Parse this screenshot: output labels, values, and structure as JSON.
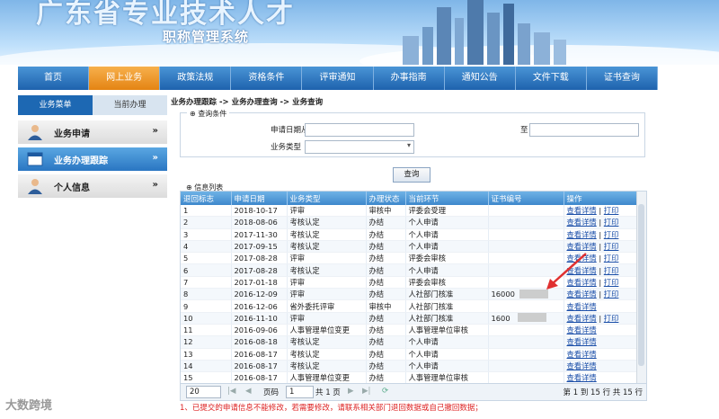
{
  "banner": {
    "title": "广东省专业技术人才",
    "subtitle": "职称管理系统"
  },
  "nav": [
    "首页",
    "网上业务",
    "政策法规",
    "资格条件",
    "评审通知",
    "办事指南",
    "通知公告",
    "文件下载",
    "证书查询"
  ],
  "left": {
    "tabs": [
      "业务菜单",
      "当前办理"
    ],
    "menu": [
      "业务申请",
      "业务办理跟踪",
      "个人信息"
    ],
    "arrow": "»"
  },
  "crumb": "业务办理跟踪 -> 业务办理查询 -> 业务查询",
  "query": {
    "legend": "查询条件",
    "date_from_label": "申请日期从",
    "date_to_label": "至",
    "type_label": "业务类型",
    "button": "查询"
  },
  "list_label": "信息列表",
  "table": {
    "headers": [
      "退回标志",
      "申请日期",
      "业务类型",
      "办理状态",
      "当前环节",
      "证书编号",
      "操作"
    ],
    "rows": [
      [
        "1",
        "2018-10-17",
        "评审",
        "审核中",
        "评委会受理",
        "",
        "查看详情",
        "打印"
      ],
      [
        "2",
        "2018-08-06",
        "考核认定",
        "办结",
        "个人申请",
        "",
        "查看详情",
        "打印"
      ],
      [
        "3",
        "2017-11-30",
        "考核认定",
        "办结",
        "个人申请",
        "",
        "查看详情",
        "打印"
      ],
      [
        "4",
        "2017-09-15",
        "考核认定",
        "办结",
        "个人申请",
        "",
        "查看详情",
        "打印"
      ],
      [
        "5",
        "2017-08-28",
        "评审",
        "办结",
        "评委会审核",
        "",
        "查看详情",
        "打印"
      ],
      [
        "6",
        "2017-08-28",
        "考核认定",
        "办结",
        "个人申请",
        "",
        "查看详情",
        "打印"
      ],
      [
        "7",
        "2017-01-18",
        "评审",
        "办结",
        "评委会审核",
        "",
        "查看详情",
        "打印"
      ],
      [
        "8",
        "2016-12-09",
        "评审",
        "办结",
        "人社部门核准",
        "16000",
        "查看详情",
        "打印"
      ],
      [
        "9",
        "2016-12-06",
        "省外委托评审",
        "审核中",
        "人社部门核准",
        "",
        "查看详情",
        ""
      ],
      [
        "10",
        "2016-11-10",
        "评审",
        "办结",
        "人社部门核准",
        "1600",
        "查看详情",
        "打印"
      ],
      [
        "11",
        "2016-09-06",
        "人事管理单位变更",
        "办结",
        "人事管理单位审核",
        "",
        "查看详情",
        ""
      ],
      [
        "12",
        "2016-08-18",
        "考核认定",
        "办结",
        "个人申请",
        "",
        "查看详情",
        ""
      ],
      [
        "13",
        "2016-08-17",
        "考核认定",
        "办结",
        "个人申请",
        "",
        "查看详情",
        ""
      ],
      [
        "14",
        "2016-08-17",
        "考核认定",
        "办结",
        "个人申请",
        "",
        "查看详情",
        ""
      ],
      [
        "15",
        "2016-08-17",
        "人事管理单位变更",
        "办结",
        "人事管理单位审核",
        "",
        "查看详情",
        ""
      ]
    ]
  },
  "pager": {
    "page_size": "20",
    "page_label": "页码",
    "page": "1",
    "total_pages": "共 1 页",
    "summary": "第 1 到 15 行 共 15 行"
  },
  "note": "1、已提交的申请信息不能修改，若需要修改，请联系相关部门退回数据或自己撤回数据；",
  "watermark": "大数跨境",
  "colors": {
    "nav": "#2a72bd",
    "nav_active": "#ef9a2c",
    "header": "#4b95d4",
    "note": "#dd2222"
  }
}
